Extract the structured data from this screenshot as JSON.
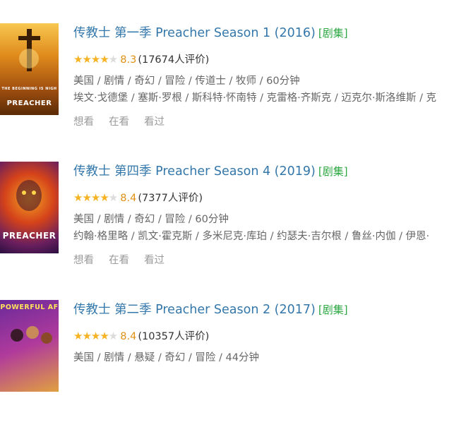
{
  "results": [
    {
      "poster": {
        "tagline": "THE BEGINNING IS NIGH",
        "name": "PREACHER",
        "colors": [
          "#7a3d0a",
          "#e08b1c",
          "#f5c04a"
        ]
      },
      "title": "传教士 第一季 Preacher Season 1 (2016)",
      "tag": "[剧集]",
      "stars_full": "★★★★",
      "stars_empty": "★",
      "score": "8.3",
      "votes": "(17674人评价)",
      "meta1": "美国 / 剧情 / 奇幻 / 冒险 / 传道士 / 牧师 / 60分钟",
      "meta2": "埃文·戈德堡 / 塞斯·罗根 / 斯科特·怀南特 / 克雷格·齐斯克 / 迈克尔·斯洛维斯 / 克",
      "actions": [
        "想看",
        "在看",
        "看过"
      ]
    },
    {
      "poster": {
        "tagline": "",
        "name": "PREACHER",
        "colors": [
          "#3a1a5c",
          "#c2411d",
          "#f08a20"
        ]
      },
      "title": "传教士 第四季 Preacher Season 4 (2019)",
      "tag": "[剧集]",
      "stars_full": "★★★★",
      "stars_empty": "★",
      "score": "8.4",
      "votes": "(7377人评价)",
      "meta1": "美国 / 剧情 / 奇幻 / 冒险 / 60分钟",
      "meta2": "约翰·格里略 / 凯文·霍克斯 / 多米尼克·库珀 / 约瑟夫·吉尔根 / 鲁丝·内伽 / 伊恩·",
      "actions": [
        "想看",
        "在看",
        "看过"
      ]
    },
    {
      "poster": {
        "tagline": "POWERFUL AF",
        "name": "",
        "colors": [
          "#5c1f8a",
          "#b03a9c",
          "#e0b040"
        ]
      },
      "title": "传教士 第二季 Preacher Season 2 (2017)",
      "tag": "[剧集]",
      "stars_full": "★★★★",
      "stars_empty": "★",
      "score": "8.4",
      "votes": "(10357人评价)",
      "meta1": "美国 / 剧情 / 悬疑 / 奇幻 / 冒险 / 44分钟",
      "meta2": "",
      "actions": [
        "想看",
        "在看",
        "看过"
      ]
    }
  ]
}
